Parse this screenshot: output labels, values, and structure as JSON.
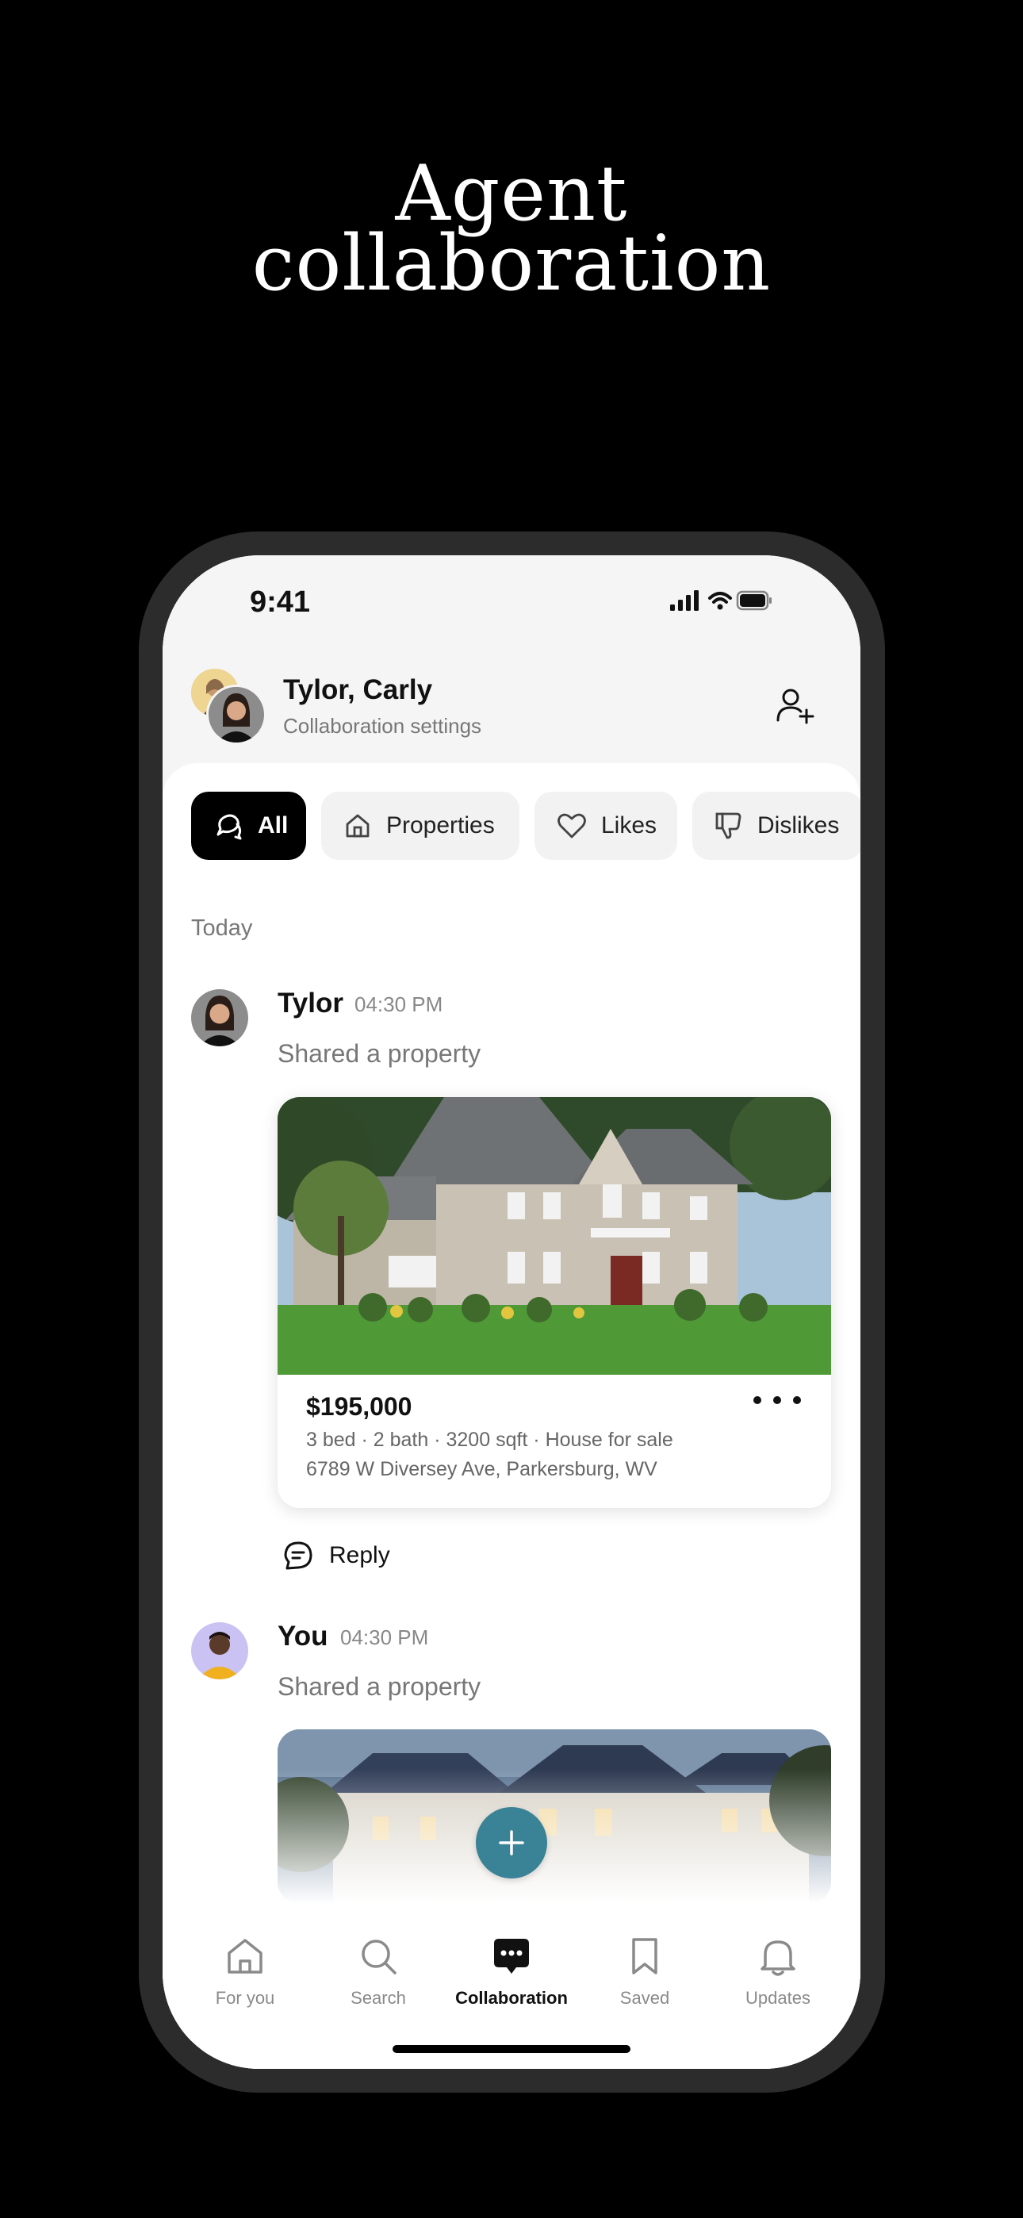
{
  "promo": {
    "title_line1": "Agent",
    "title_line2": "collaboration"
  },
  "status_bar": {
    "time": "9:41"
  },
  "conversation": {
    "name": "Tylor, Carly",
    "subtitle": "Collaboration settings"
  },
  "filters": [
    {
      "label": "All",
      "icon": "chat-bubbles-icon",
      "active": true
    },
    {
      "label": "Properties",
      "icon": "home-icon",
      "active": false
    },
    {
      "label": "Likes",
      "icon": "heart-icon",
      "active": false
    },
    {
      "label": "Dislikes",
      "icon": "thumbs-down-icon",
      "active": false
    }
  ],
  "feed": {
    "section_label": "Today",
    "messages": [
      {
        "author": "Tylor",
        "time": "04:30 PM",
        "action": "Shared a property",
        "property": {
          "price": "$195,000",
          "details": "3 bed · 2 bath · 3200 sqft · House for sale",
          "address": "6789 W Diversey Ave, Parkersburg, WV"
        },
        "reply_label": "Reply"
      },
      {
        "author": "You",
        "time": "04:30 PM",
        "action": "Shared a property"
      }
    ]
  },
  "tab_bar": [
    {
      "label": "For you",
      "icon": "home-icon",
      "active": false
    },
    {
      "label": "Search",
      "icon": "search-icon",
      "active": false
    },
    {
      "label": "Collaboration",
      "icon": "chat-icon",
      "active": true
    },
    {
      "label": "Saved",
      "icon": "bookmark-icon",
      "active": false
    },
    {
      "label": "Updates",
      "icon": "bell-icon",
      "active": false
    }
  ],
  "colors": {
    "fab": "#3a8296",
    "active_chip": "#000000",
    "background": "#000000"
  }
}
